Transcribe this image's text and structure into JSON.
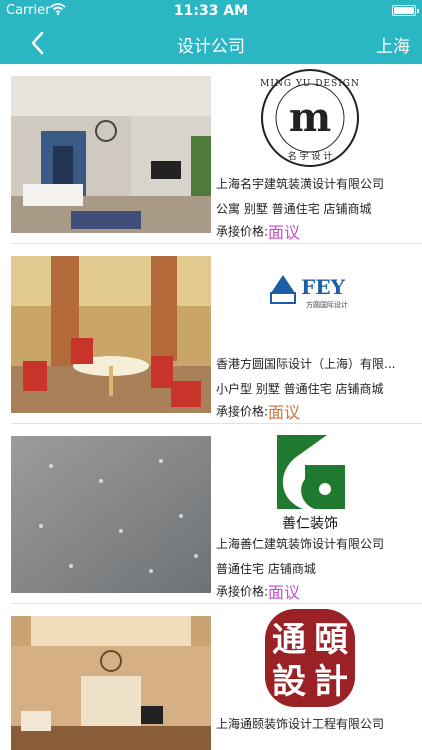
{
  "status_bar": {
    "carrier": "Carrier",
    "time": "11:33 AM"
  },
  "nav": {
    "title": "设计公司",
    "city": "上海",
    "back_icon": "chevron-left-icon"
  },
  "colors": {
    "header": "#2bb6c4",
    "price_primary": "#c64fc9",
    "price_secondary": "#c8763e"
  },
  "companies": [
    {
      "name": "上海名宇建筑装潢设计有限公司",
      "tags": "公寓 别墅 普通住宅 店铺商城",
      "price_label": "承接价格:",
      "price_value": "面议",
      "logo": {
        "top": "MING YU DESIGN",
        "mark": "m",
        "bottom": "名 宇 设 计"
      }
    },
    {
      "name": "香港方圆国际设计（上海）有限...",
      "tags": "小户型 别墅 普通住宅 店铺商城",
      "price_label": "承接价格:",
      "price_value": "面议",
      "logo": {
        "mark": "FEY",
        "sub": "方圆国际设计"
      }
    },
    {
      "name": "上海善仁建筑装饰设计有限公司",
      "tags": "普通住宅 店铺商城",
      "price_label": "承接价格:",
      "price_value": "面议",
      "logo": {
        "mark": "善仁装饰"
      }
    },
    {
      "name": "上海通颐装饰设计工程有限公司",
      "tags": "",
      "price_label": "",
      "price_value": "",
      "logo": {
        "chars": [
          "通",
          "頤",
          "設",
          "計"
        ]
      }
    }
  ]
}
